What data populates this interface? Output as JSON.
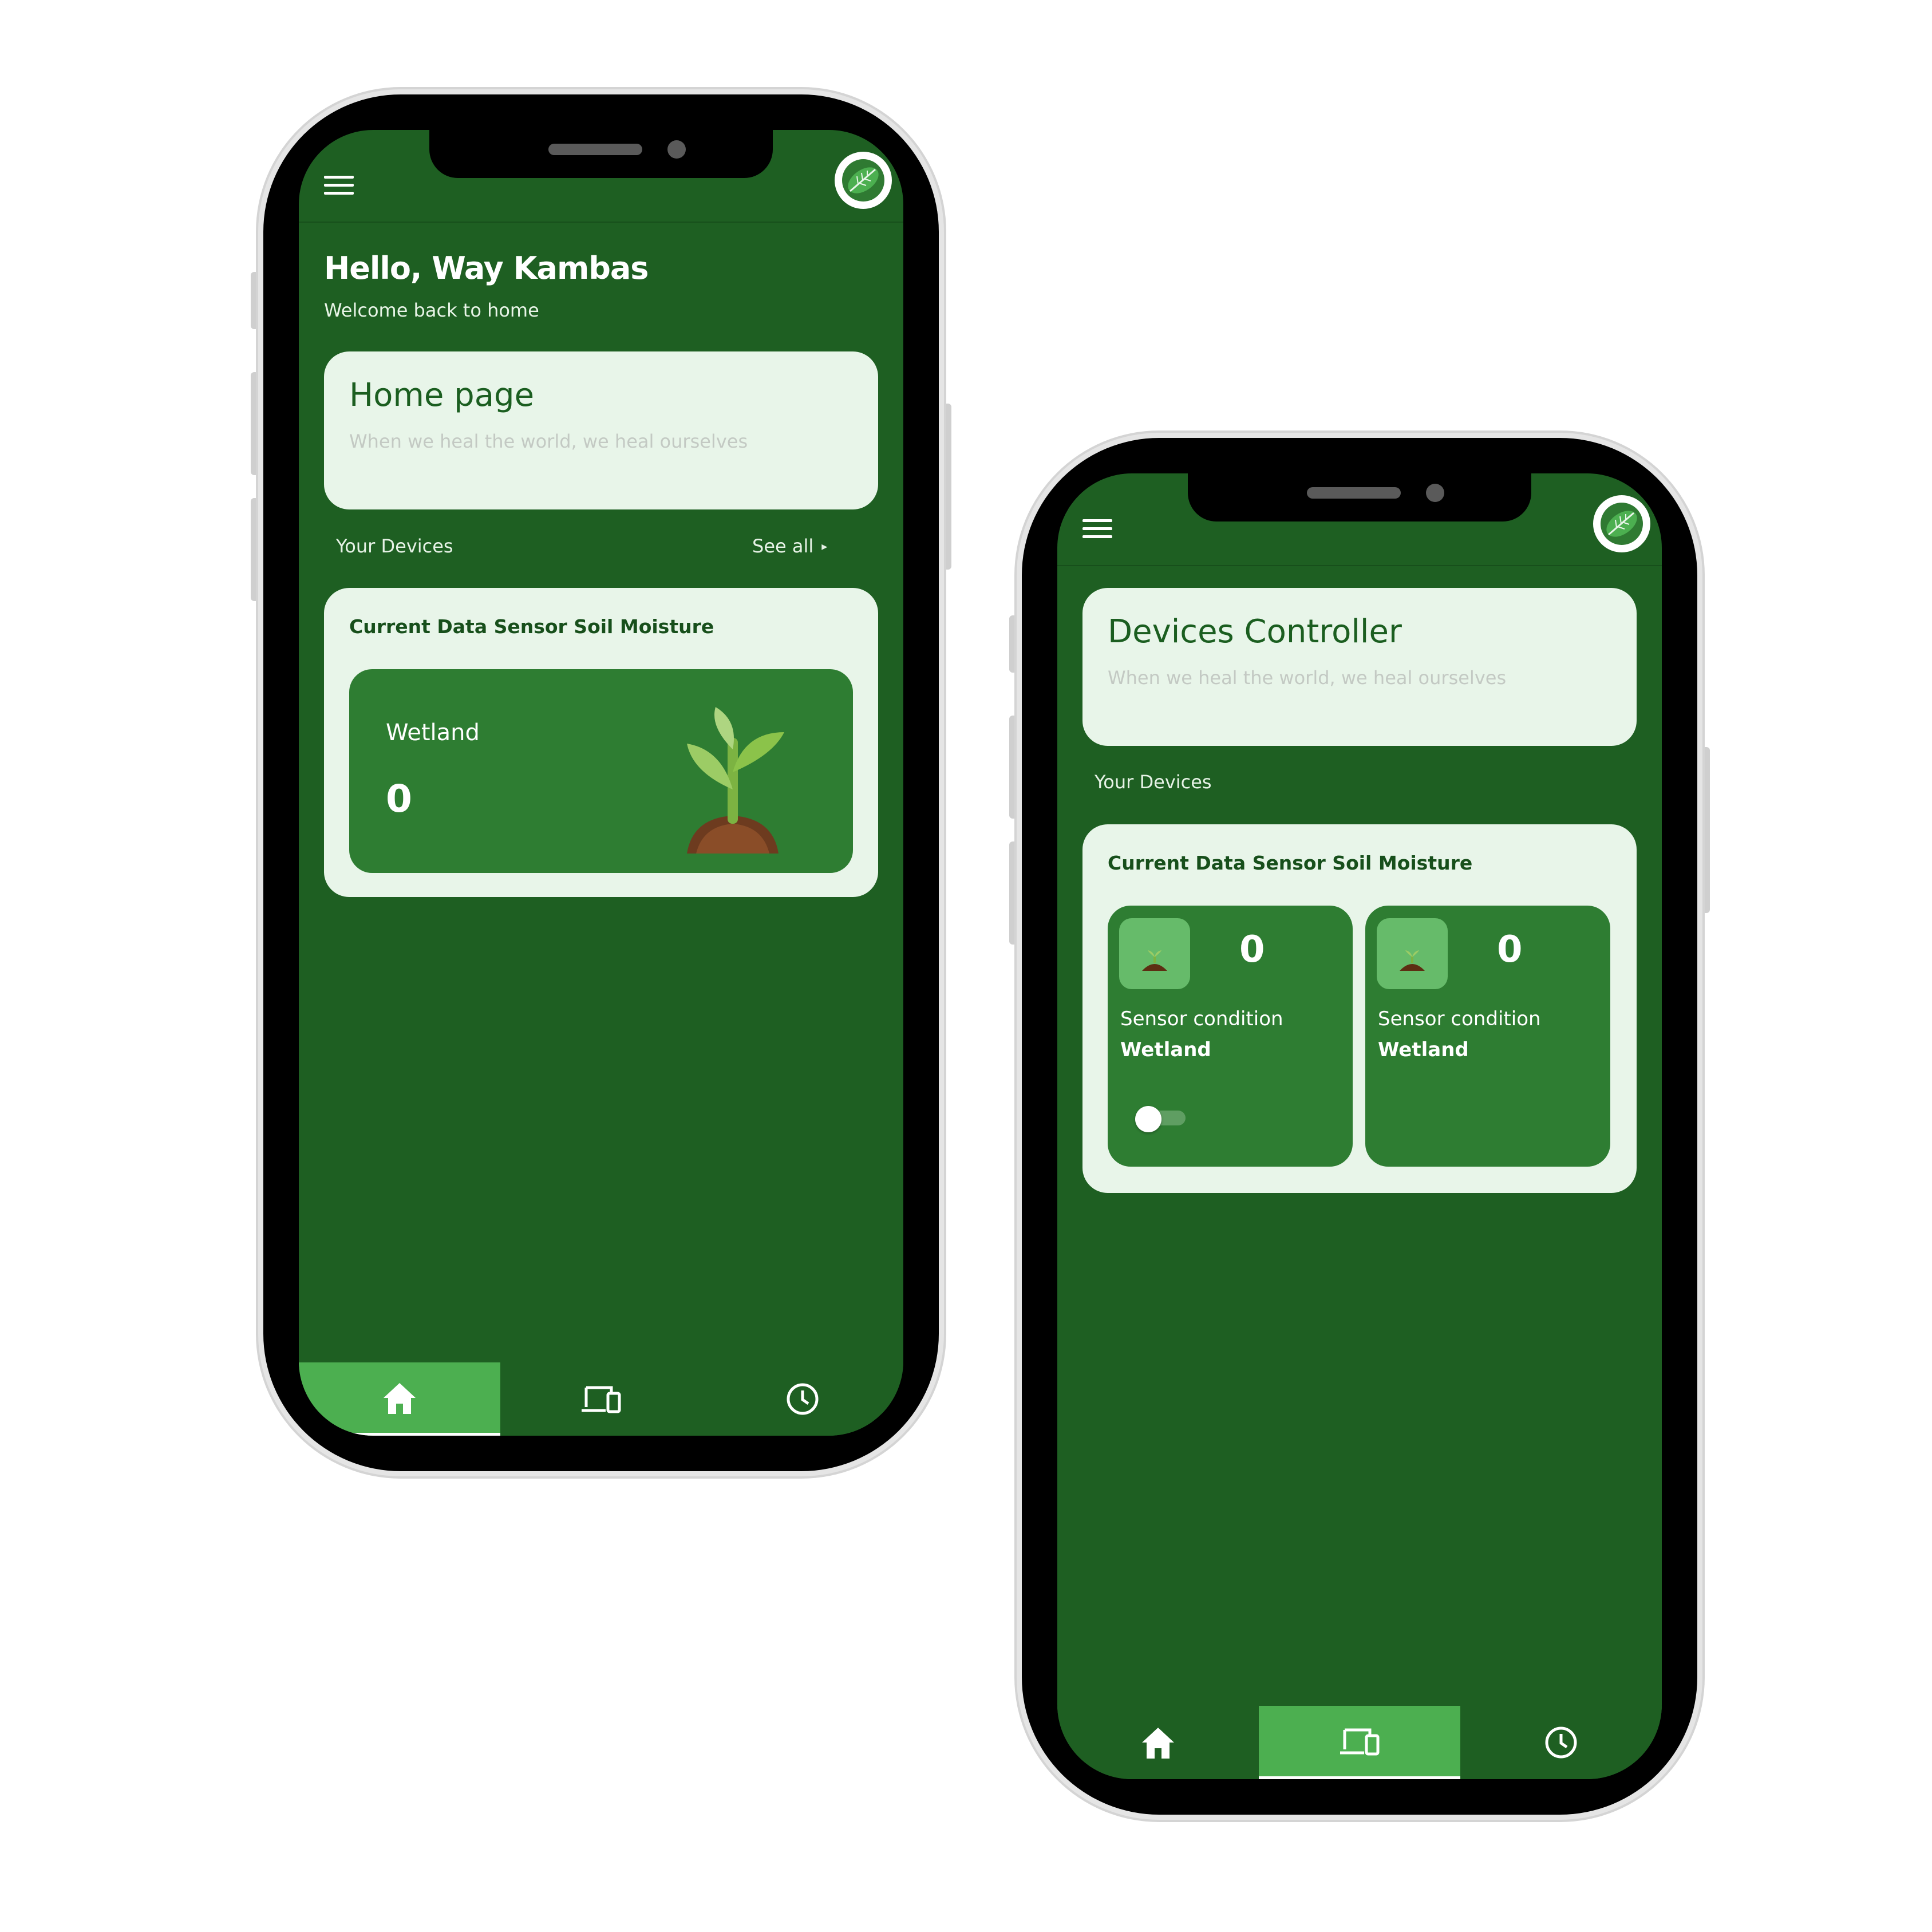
{
  "colors": {
    "screen_bg": "#1e5f22",
    "card_bg": "#e8f5e9",
    "sensor_bg": "#2e7d32",
    "active_tab": "#4caf50",
    "title_green": "#1b5e20"
  },
  "phone1": {
    "greeting": "Hello, Way Kambas",
    "subgreeting": "Welcome back to home",
    "hero": {
      "title": "Home page",
      "subtitle": "When we heal the world, we heal ourselves"
    },
    "devices_label": "Your Devices",
    "see_all": "See all",
    "data_card": {
      "title": "Current Data Sensor Soil Moisture",
      "condition": "Wetland",
      "value": "0",
      "icon": "plant-sprout-icon"
    },
    "nav": {
      "active": "home",
      "tabs": [
        "home-icon",
        "devices-icon",
        "history-clock-icon"
      ]
    }
  },
  "phone2": {
    "hero": {
      "title": "Devices Controller",
      "subtitle": "When we heal the world, we heal ourselves"
    },
    "devices_label": "Your Devices",
    "data_card": {
      "title": "Current Data Sensor Soil Moisture",
      "sensors": [
        {
          "value": "0",
          "label": "Sensor condition",
          "condition": "Wetland",
          "has_toggle": true,
          "toggle_on": false
        },
        {
          "value": "0",
          "label": "Sensor condition",
          "condition": "Wetland",
          "has_toggle": false
        }
      ]
    },
    "nav": {
      "active": "devices",
      "tabs": [
        "home-icon",
        "devices-icon",
        "history-clock-icon"
      ]
    }
  }
}
